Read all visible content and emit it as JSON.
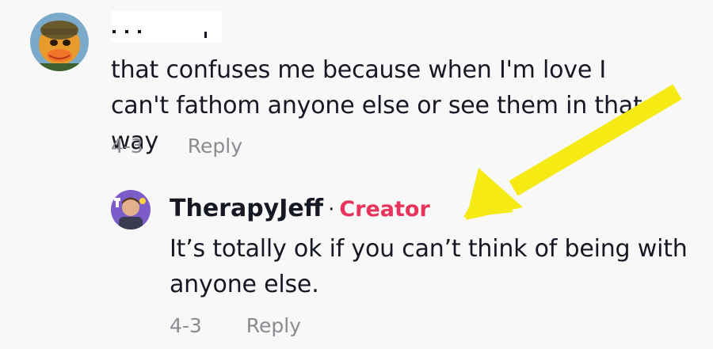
{
  "comments": [
    {
      "author": "",
      "text": "that confuses me because when I'm love I can't fathom anyone else or see them in that way",
      "date": "4-3",
      "reply_label": "Reply"
    }
  ],
  "reply": {
    "author": "TherapyJeff",
    "separator": "·",
    "badge": "Creator",
    "text": "It’s totally ok if you can’t think of being with anyone else.",
    "date": "4-3",
    "reply_label": "Reply"
  },
  "colors": {
    "background": "#f8f8f8",
    "text": "#161823",
    "meta": "#8a8b91",
    "creator_badge": "#e8335c",
    "annotation_arrow": "#f5ea14"
  },
  "icons": [
    "commenter-avatar",
    "therapyjeff-avatar",
    "annotation-arrow-icon"
  ]
}
